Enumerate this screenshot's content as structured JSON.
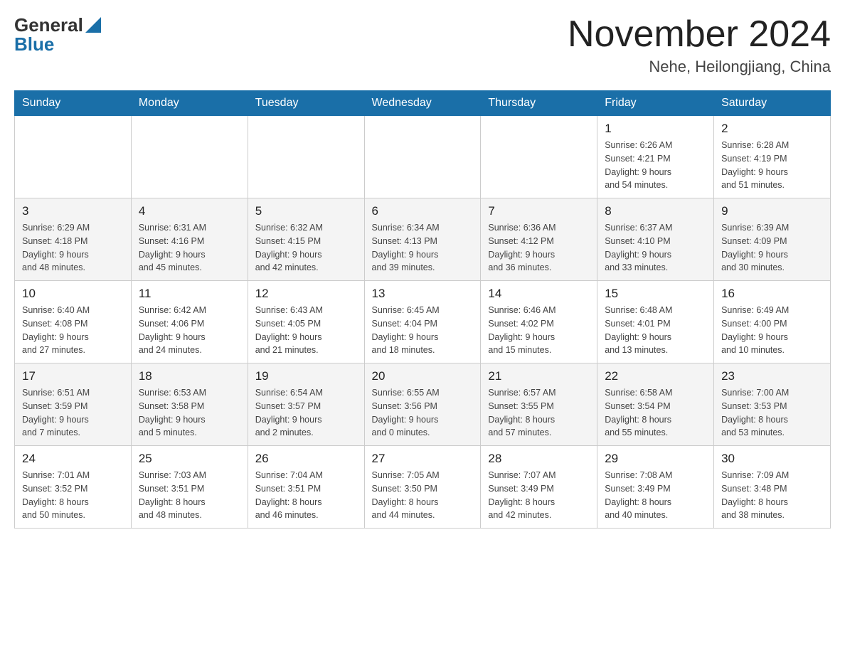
{
  "header": {
    "logo": {
      "general": "General",
      "blue": "Blue"
    },
    "title": "November 2024",
    "location": "Nehe, Heilongjiang, China"
  },
  "days_of_week": [
    "Sunday",
    "Monday",
    "Tuesday",
    "Wednesday",
    "Thursday",
    "Friday",
    "Saturday"
  ],
  "weeks": [
    {
      "days": [
        {
          "number": "",
          "info": ""
        },
        {
          "number": "",
          "info": ""
        },
        {
          "number": "",
          "info": ""
        },
        {
          "number": "",
          "info": ""
        },
        {
          "number": "",
          "info": ""
        },
        {
          "number": "1",
          "info": "Sunrise: 6:26 AM\nSunset: 4:21 PM\nDaylight: 9 hours\nand 54 minutes."
        },
        {
          "number": "2",
          "info": "Sunrise: 6:28 AM\nSunset: 4:19 PM\nDaylight: 9 hours\nand 51 minutes."
        }
      ]
    },
    {
      "days": [
        {
          "number": "3",
          "info": "Sunrise: 6:29 AM\nSunset: 4:18 PM\nDaylight: 9 hours\nand 48 minutes."
        },
        {
          "number": "4",
          "info": "Sunrise: 6:31 AM\nSunset: 4:16 PM\nDaylight: 9 hours\nand 45 minutes."
        },
        {
          "number": "5",
          "info": "Sunrise: 6:32 AM\nSunset: 4:15 PM\nDaylight: 9 hours\nand 42 minutes."
        },
        {
          "number": "6",
          "info": "Sunrise: 6:34 AM\nSunset: 4:13 PM\nDaylight: 9 hours\nand 39 minutes."
        },
        {
          "number": "7",
          "info": "Sunrise: 6:36 AM\nSunset: 4:12 PM\nDaylight: 9 hours\nand 36 minutes."
        },
        {
          "number": "8",
          "info": "Sunrise: 6:37 AM\nSunset: 4:10 PM\nDaylight: 9 hours\nand 33 minutes."
        },
        {
          "number": "9",
          "info": "Sunrise: 6:39 AM\nSunset: 4:09 PM\nDaylight: 9 hours\nand 30 minutes."
        }
      ]
    },
    {
      "days": [
        {
          "number": "10",
          "info": "Sunrise: 6:40 AM\nSunset: 4:08 PM\nDaylight: 9 hours\nand 27 minutes."
        },
        {
          "number": "11",
          "info": "Sunrise: 6:42 AM\nSunset: 4:06 PM\nDaylight: 9 hours\nand 24 minutes."
        },
        {
          "number": "12",
          "info": "Sunrise: 6:43 AM\nSunset: 4:05 PM\nDaylight: 9 hours\nand 21 minutes."
        },
        {
          "number": "13",
          "info": "Sunrise: 6:45 AM\nSunset: 4:04 PM\nDaylight: 9 hours\nand 18 minutes."
        },
        {
          "number": "14",
          "info": "Sunrise: 6:46 AM\nSunset: 4:02 PM\nDaylight: 9 hours\nand 15 minutes."
        },
        {
          "number": "15",
          "info": "Sunrise: 6:48 AM\nSunset: 4:01 PM\nDaylight: 9 hours\nand 13 minutes."
        },
        {
          "number": "16",
          "info": "Sunrise: 6:49 AM\nSunset: 4:00 PM\nDaylight: 9 hours\nand 10 minutes."
        }
      ]
    },
    {
      "days": [
        {
          "number": "17",
          "info": "Sunrise: 6:51 AM\nSunset: 3:59 PM\nDaylight: 9 hours\nand 7 minutes."
        },
        {
          "number": "18",
          "info": "Sunrise: 6:53 AM\nSunset: 3:58 PM\nDaylight: 9 hours\nand 5 minutes."
        },
        {
          "number": "19",
          "info": "Sunrise: 6:54 AM\nSunset: 3:57 PM\nDaylight: 9 hours\nand 2 minutes."
        },
        {
          "number": "20",
          "info": "Sunrise: 6:55 AM\nSunset: 3:56 PM\nDaylight: 9 hours\nand 0 minutes."
        },
        {
          "number": "21",
          "info": "Sunrise: 6:57 AM\nSunset: 3:55 PM\nDaylight: 8 hours\nand 57 minutes."
        },
        {
          "number": "22",
          "info": "Sunrise: 6:58 AM\nSunset: 3:54 PM\nDaylight: 8 hours\nand 55 minutes."
        },
        {
          "number": "23",
          "info": "Sunrise: 7:00 AM\nSunset: 3:53 PM\nDaylight: 8 hours\nand 53 minutes."
        }
      ]
    },
    {
      "days": [
        {
          "number": "24",
          "info": "Sunrise: 7:01 AM\nSunset: 3:52 PM\nDaylight: 8 hours\nand 50 minutes."
        },
        {
          "number": "25",
          "info": "Sunrise: 7:03 AM\nSunset: 3:51 PM\nDaylight: 8 hours\nand 48 minutes."
        },
        {
          "number": "26",
          "info": "Sunrise: 7:04 AM\nSunset: 3:51 PM\nDaylight: 8 hours\nand 46 minutes."
        },
        {
          "number": "27",
          "info": "Sunrise: 7:05 AM\nSunset: 3:50 PM\nDaylight: 8 hours\nand 44 minutes."
        },
        {
          "number": "28",
          "info": "Sunrise: 7:07 AM\nSunset: 3:49 PM\nDaylight: 8 hours\nand 42 minutes."
        },
        {
          "number": "29",
          "info": "Sunrise: 7:08 AM\nSunset: 3:49 PM\nDaylight: 8 hours\nand 40 minutes."
        },
        {
          "number": "30",
          "info": "Sunrise: 7:09 AM\nSunset: 3:48 PM\nDaylight: 8 hours\nand 38 minutes."
        }
      ]
    }
  ]
}
